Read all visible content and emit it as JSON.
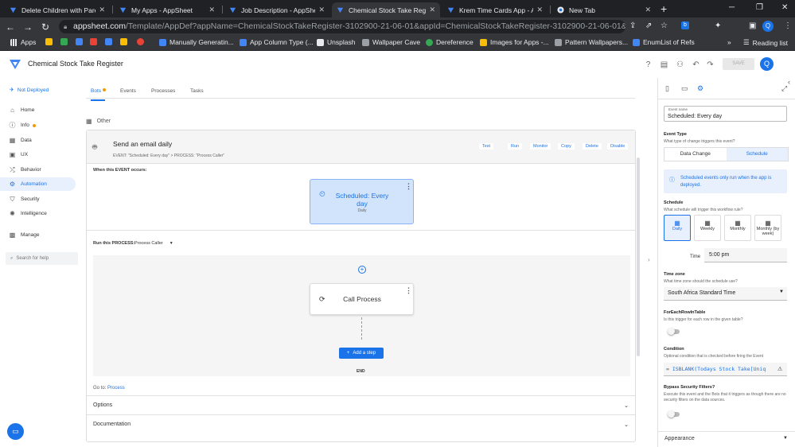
{
  "browser": {
    "tabs": [
      {
        "title": "Delete Children with Parent",
        "favicon": "appsheet-icon"
      },
      {
        "title": "My Apps - AppSheet",
        "favicon": "appsheet-icon"
      },
      {
        "title": "Job Description - AppSheet",
        "favicon": "appsheet-icon"
      },
      {
        "title": "Chemical Stock Take Regist",
        "favicon": "appsheet-icon"
      },
      {
        "title": "Krem Time Cards App - Ap",
        "favicon": "appsheet-icon"
      },
      {
        "title": "New Tab",
        "favicon": "chrome-icon"
      }
    ],
    "url_host": "appsheet.com",
    "url_path": "/Template/AppDef?appName=ChemicalStockTakeRegister-3102900-21-06-01&appId=ChemicalStockTakeRegister-3102900-21-06-01&quickStart=False#Au...",
    "profile_initial": "Q",
    "bookmarks": [
      "Apps",
      "Manually Generatin...",
      "App Column Type (...",
      "Unsplash",
      "Wallpaper Cave",
      "Dereference",
      "Images for Apps -...",
      "Pattern Wallpapers...",
      "EnumList of Refs"
    ],
    "reading_list": "Reading list",
    "more": "»"
  },
  "app": {
    "name": "Chemical Stock Take Register",
    "save_label": "SAVE",
    "avatar": "Q"
  },
  "leftnav": {
    "deploy_status": "Not Deployed",
    "items": [
      {
        "label": "Home",
        "icon": "home-icon"
      },
      {
        "label": "Info",
        "icon": "info-icon"
      },
      {
        "label": "Data",
        "icon": "data-icon"
      },
      {
        "label": "UX",
        "icon": "ux-icon"
      },
      {
        "label": "Behavior",
        "icon": "behavior-icon"
      },
      {
        "label": "Automation",
        "icon": "automation-icon"
      },
      {
        "label": "Security",
        "icon": "security-icon"
      },
      {
        "label": "Intelligence",
        "icon": "intelligence-icon"
      },
      {
        "label": "Manage",
        "icon": "manage-icon"
      }
    ],
    "search_placeholder": "Search for help"
  },
  "main": {
    "tabs": [
      "Bots",
      "Events",
      "Processes",
      "Tasks"
    ],
    "section": "Other",
    "bot": {
      "title": "Send an email daily",
      "subtitle": "EVENT: \"Scheduled: Every day\" > PROCESS: \"Process Caller\"",
      "actions": [
        "Test",
        "Run",
        "Monitor",
        "Copy",
        "Delete",
        "Disable"
      ]
    },
    "when_label": "When this EVENT occurs:",
    "event": {
      "title": "Scheduled: Every day",
      "subtitle": "Daily"
    },
    "run_label": "Run this PROCESS:",
    "process_name": "Process Caller",
    "step": {
      "title": "Call Process"
    },
    "add_step": "Add a step",
    "end": "END",
    "goto_label": "Go to:",
    "goto_link": "Process",
    "options": "Options",
    "documentation": "Documentation"
  },
  "panel": {
    "event_name_label": "Event name",
    "event_name": "Scheduled: Every day",
    "event_type_label": "Event Type",
    "event_type_hint": "What type of change triggers this event?",
    "event_types": [
      "Data Change",
      "Schedule"
    ],
    "info": "Scheduled events only run when the app is deployed.",
    "schedule_label": "Schedule",
    "schedule_hint": "What schedule will trigger this workflow rule?",
    "schedule_options": [
      "Daily",
      "Weekly",
      "Monthly",
      "Monthly (by week)"
    ],
    "time_label": "Time",
    "time_value": "5:00 pm",
    "tz_label": "Time zone",
    "tz_hint": "What time zone should the schedule use?",
    "tz_value": "South Africa Standard Time",
    "foreach_label": "ForEachRowInTable",
    "foreach_hint": "Is this trigger for each row in the given table?",
    "condition_label": "Condition",
    "condition_hint": "Optional condition that is checked before firing the Event",
    "condition_eq": "=",
    "condition_value": "ISBLANK(Todays Stock Take[Uniq",
    "bypass_label": "Bypass Security Filters?",
    "bypass_hint": "Execute this event and the Bots that it triggers as though there are no security filters on the data sources.",
    "appearance": "Appearance"
  },
  "colors": {
    "accent": "#1a73e8",
    "event_bg": "#d2e3fc",
    "warning_dot": "#f29900"
  }
}
